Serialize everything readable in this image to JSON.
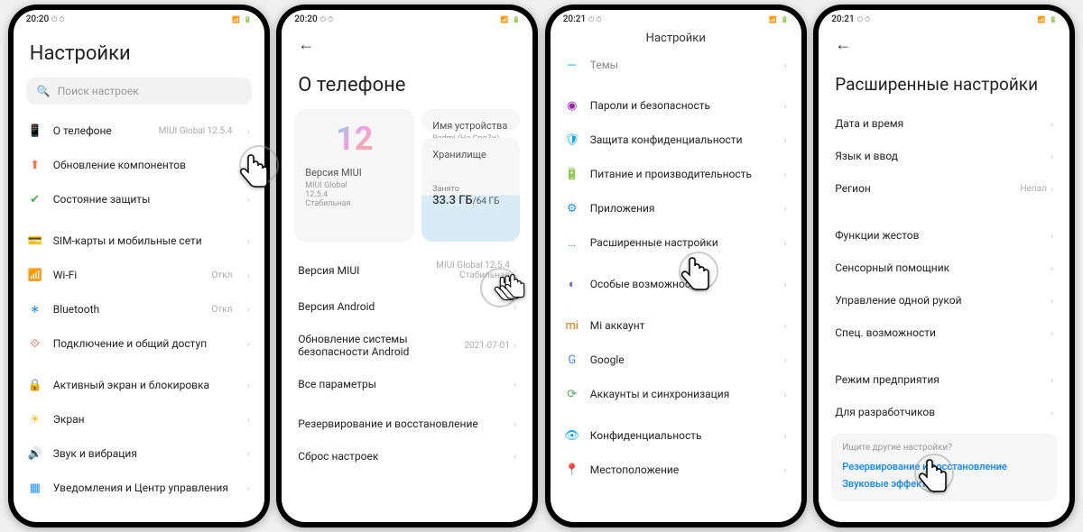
{
  "status": {
    "time1": "20:20",
    "time2": "20:21",
    "icons_left": "⏰ ⏲",
    "icons_right": "📶 🔋 83"
  },
  "phone1": {
    "title": "Настройки",
    "search_placeholder": "Поиск настроек",
    "items": [
      {
        "icon": "📱",
        "color": "#2196f3",
        "label": "О телефоне",
        "value": "MIUI Global 12.5.4"
      },
      {
        "icon": "⬆",
        "color": "#ff7043",
        "label": "Обновление компонентов",
        "value": ""
      },
      {
        "icon": "✔",
        "color": "#4caf50",
        "label": "Состояние защиты",
        "value": ""
      }
    ],
    "items2": [
      {
        "icon": "💳",
        "color": "#ffb300",
        "label": "SIM-карты и мобильные сети",
        "value": ""
      },
      {
        "icon": "📶",
        "color": "#29b6f6",
        "label": "Wi-Fi",
        "value": "Откл"
      },
      {
        "icon": "∗",
        "color": "#2196f3",
        "label": "Bluetooth",
        "value": "Откл"
      },
      {
        "icon": "⟐",
        "color": "#ff5722",
        "label": "Подключение и общий доступ",
        "value": ""
      }
    ],
    "items3": [
      {
        "icon": "🔒",
        "color": "#f44336",
        "label": "Активный экран и блокировка",
        "value": ""
      },
      {
        "icon": "☀",
        "color": "#ffc107",
        "label": "Экран",
        "value": ""
      },
      {
        "icon": "🔊",
        "color": "#4caf50",
        "label": "Звук и вибрация",
        "value": ""
      },
      {
        "icon": "▦",
        "color": "#2196f3",
        "label": "Уведомления и Центр управления",
        "value": ""
      }
    ]
  },
  "phone2": {
    "title": "О телефоне",
    "miui_card": {
      "title": "Версия MIUI",
      "sub1": "MIUI Global",
      "sub2": "12.5.4",
      "sub3": "Стабильная"
    },
    "device_card": {
      "title": "Имя устройства",
      "sub": "Redmi (На СвяZи)"
    },
    "storage_card": {
      "title": "Хранилище",
      "used_label": "Занято",
      "used": "33.3 ГБ",
      "total": "/64 ГБ"
    },
    "rows": [
      {
        "label": "Версия MIUI",
        "value": "MIUI Global 12.5.4\nСтабильная"
      },
      {
        "label": "Версия Android",
        "value": ""
      },
      {
        "label": "Обновление системы безопасности Android",
        "value": "2021-07-01"
      },
      {
        "label": "Все параметры",
        "value": ""
      }
    ],
    "rows2": [
      {
        "label": "Резервирование и восстановление",
        "value": ""
      },
      {
        "label": "Сброс настроек",
        "value": ""
      }
    ]
  },
  "phone3": {
    "title": "Настройки",
    "partial": "Темы",
    "items": [
      {
        "icon": "◉",
        "color": "#9c27b0",
        "label": "Пароли и безопасность"
      },
      {
        "icon": "🛡",
        "color": "#03a9f4",
        "label": "Защита конфиденциальности"
      },
      {
        "icon": "🔋",
        "color": "#4caf50",
        "label": "Питание и производительность"
      },
      {
        "icon": "⚙",
        "color": "#2196f3",
        "label": "Приложения"
      },
      {
        "icon": "…",
        "color": "#607d8b",
        "label": "Расширенные настройки"
      }
    ],
    "items2": [
      {
        "icon": "◐",
        "color": "#7e57c2",
        "label": "Особые возможности"
      }
    ],
    "items3": [
      {
        "icon": "mi",
        "color": "#ff6f00",
        "label": "Mi аккаунт"
      },
      {
        "icon": "G",
        "color": "#4285f4",
        "label": "Google"
      },
      {
        "icon": "⟳",
        "color": "#4caf50",
        "label": "Аккаунты и синхронизация"
      }
    ],
    "items4": [
      {
        "icon": "👁",
        "color": "#03a9f4",
        "label": "Конфиденциальность"
      },
      {
        "icon": "📍",
        "color": "#ff9800",
        "label": "Местоположение"
      }
    ]
  },
  "phone4": {
    "title": "Расширенные настройки",
    "items": [
      {
        "label": "Дата и время"
      },
      {
        "label": "Язык и ввод"
      },
      {
        "label": "Регион",
        "value": "Непал"
      }
    ],
    "items2": [
      {
        "label": "Функции жестов"
      },
      {
        "label": "Сенсорный помощник"
      },
      {
        "label": "Управление одной рукой"
      },
      {
        "label": "Спец. возможности"
      }
    ],
    "items3": [
      {
        "label": "Режим предприятия"
      },
      {
        "label": "Для разработчиков"
      }
    ],
    "hint": {
      "title": "Ищите другие настройки?",
      "link1": "Резервирование и восстановление",
      "link2": "Звуковые эффекты"
    }
  }
}
